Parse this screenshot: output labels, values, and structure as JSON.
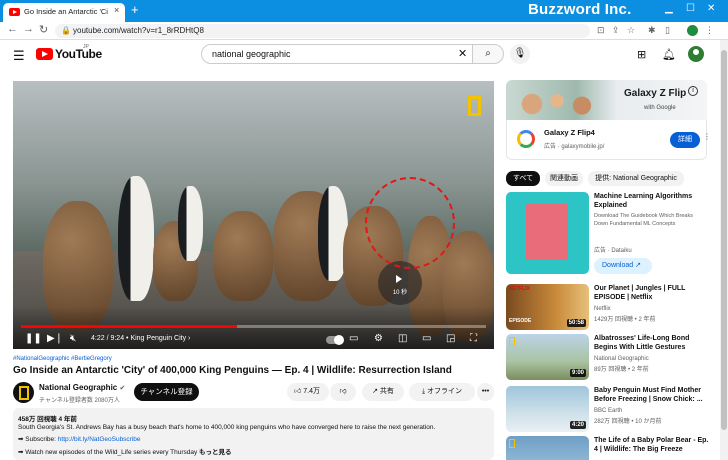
{
  "browser": {
    "tab_title": "Go Inside an Antarctic 'City' of 40",
    "tab_close": "×",
    "new_tab": "+",
    "url": "youtube.com/watch?v=r1_8rRDHtQ8",
    "watermark": "Buzzword Inc."
  },
  "header": {
    "logo_text": "YouTube",
    "logo_region": "JP",
    "search_value": "national geographic"
  },
  "player": {
    "time": "4:22 / 9:24",
    "chapter": "• King Penguin City",
    "progress": 0.465,
    "skip_label": "10 秒"
  },
  "video": {
    "hashtags": "#NationalGeographic #BertieGregory",
    "title": "Go Inside an Antarctic 'City' of 400,000 King Penguins — Ep. 4 | Wildlife: Resurrection Island",
    "channel_name": "National Geographic",
    "verified": "✔",
    "channel_subs": "チャンネル登録者数 2080万人",
    "subscribe_label": "チャンネル登録",
    "like_count": "7.4万",
    "share_label": "共有",
    "offline_label": "オフライン",
    "more_label": "•••"
  },
  "description": {
    "stats": "458万 回視聴  4 年前",
    "line1": "South Georgia's St. Andrews Bay has a busy beach that's home to 400,000 king penguins who have converged here to raise the next generation.",
    "line2_prefix": "➡ Subscribe: ",
    "line2_link": "http://bit.ly/NatGeoSubscribe",
    "line3": "➡ Watch new episodes of the Wild_Life series every Thursday",
    "show_more": "もっと見る"
  },
  "ad": {
    "brand": "Galaxy Z Flip",
    "with_google": "with Google",
    "info": "i",
    "title": "Galaxy Z Flip4",
    "sub": "広告 · galaxymobile.jp/",
    "button": "詳細",
    "dots": "⋮"
  },
  "chips": [
    "すべて",
    "関連動画",
    "提供: National Geographic"
  ],
  "recommendations": [
    {
      "title": "Machine Learning Algorithms Explained",
      "desc": "Download The Guidebook Which Breaks Down Fundamental ML Concepts",
      "meta": "広告 · Dataiku",
      "button": "Download"
    },
    {
      "title": "Our Planet | Jungles | FULL EPISODE | Netflix",
      "channel": "Netflix",
      "meta": "1429万 回視聴 • 2 年前",
      "duration": "50:58",
      "badge": "NETFLIX",
      "tag": "EPISODE"
    },
    {
      "title": "Albatrosses' Life-Long Bond Begins With Little Gestures",
      "channel": "National Geographic",
      "meta": "89万 回視聴 • 2 年前",
      "duration": "9:00"
    },
    {
      "title": "Baby Penguin Must Find Mother Before Freezing | Snow Chick: ...",
      "channel": "BBC Earth",
      "meta": "282万 回視聴 • 10 か月前",
      "duration": "4:20"
    },
    {
      "title": "The Life of a Baby Polar Bear - Ep. 4 | Wildlife: The Big Freeze"
    }
  ]
}
